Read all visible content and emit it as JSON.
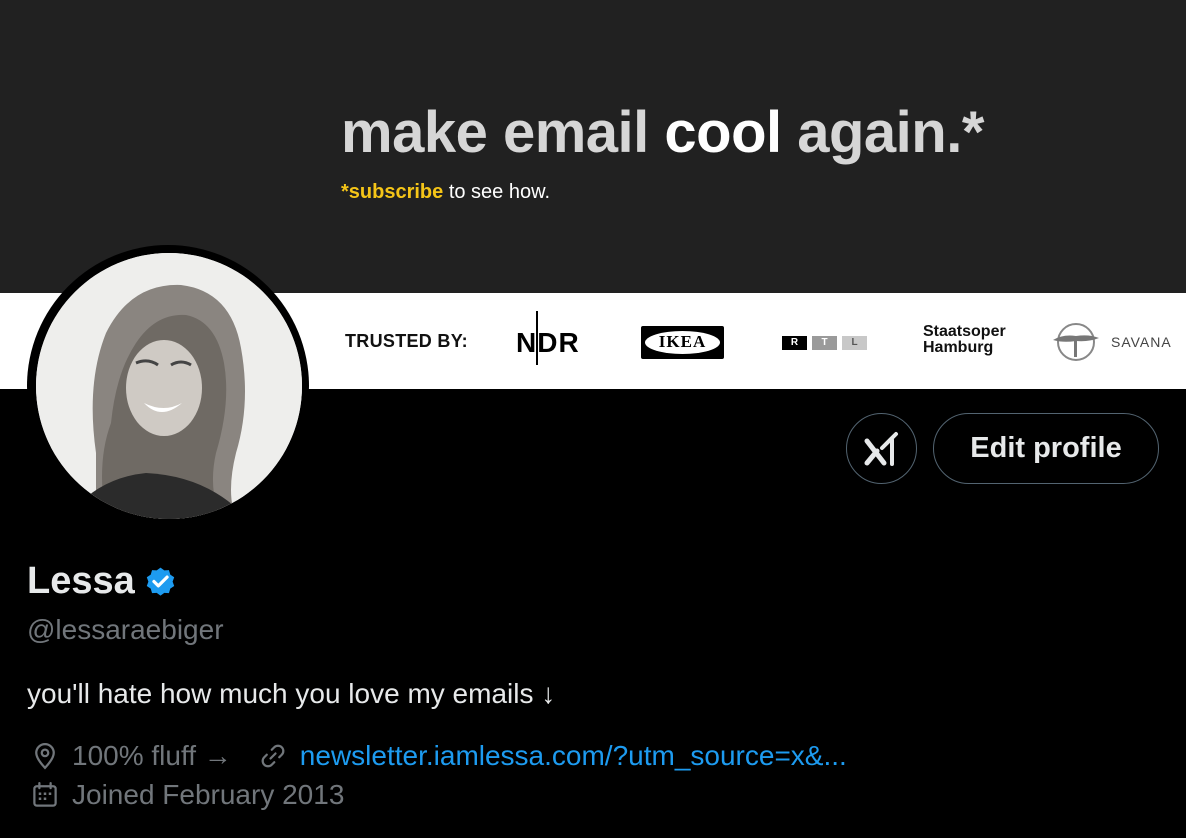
{
  "banner": {
    "headline_part1": "make email ",
    "headline_part2": "cool",
    "headline_part3": " again.*",
    "sub_highlight": "*subscribe",
    "sub_rest": " to see how.",
    "trusted_label": "TRUSTED BY:",
    "logos": {
      "ndr": "NDR",
      "ikea": "IKEA",
      "rtl": [
        "R",
        "T",
        "L"
      ],
      "staatsoper_line1": "Staatsoper",
      "staatsoper_line2": "Hamburg",
      "savana": "SAVANA"
    }
  },
  "actions": {
    "edit_profile": "Edit profile"
  },
  "profile": {
    "name": "Lessa",
    "handle": "@lessaraebiger",
    "bio": "you'll hate how much you love my emails ↓",
    "location": "100% fluff →",
    "website": "newsletter.iamlessa.com/?utm_source=x&...",
    "joined": "Joined February 2013"
  },
  "colors": {
    "background": "#000000",
    "banner_dark": "#212121",
    "accent_yellow": "#f5c518",
    "link_blue": "#1d9bf0",
    "verified_blue": "#1d9bf0",
    "muted_text": "#71767b"
  },
  "icons": {
    "location": "location-pin-icon",
    "website": "link-icon",
    "joined": "calendar-icon",
    "grok": "grok-icon",
    "verified": "verified-badge-icon"
  }
}
